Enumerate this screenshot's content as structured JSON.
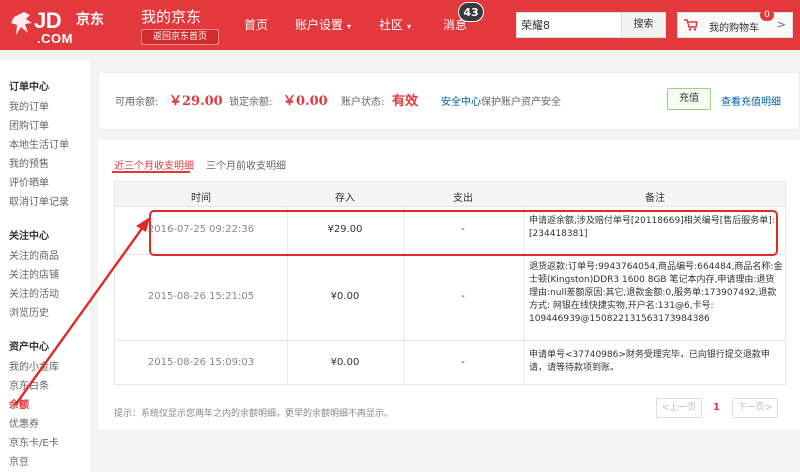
{
  "header": {
    "logo_text": "JD",
    "logo_cn": "京东",
    "logo_com": ".COM",
    "title": "我的京东",
    "back_home": "返回京东首页",
    "nav": [
      {
        "label": "首页"
      },
      {
        "label": "账户设置",
        "arrow": "▾"
      },
      {
        "label": "社区",
        "arrow": "▾"
      },
      {
        "label": "消息"
      }
    ],
    "message_count": "43",
    "search_value": "荣耀8",
    "search_button": "搜索",
    "cart_label": "我的购物车",
    "cart_count": "0",
    "cart_chevron": ">",
    "brand_color": "#e4393c"
  },
  "sidebar": {
    "sections": [
      {
        "title": "订单中心",
        "items": [
          "我的订单",
          "团购订单",
          "本地生活订单",
          "我的预售",
          "评价晒单",
          "取消订单记录"
        ]
      },
      {
        "title": "关注中心",
        "items": [
          "关注的商品",
          "关注的店铺",
          "关注的活动",
          "浏览历史"
        ]
      },
      {
        "title": "资产中心",
        "items": [
          "我的小金库",
          "京东白条",
          "余额",
          "优惠券",
          "京东卡/E卡",
          "京豆"
        ]
      }
    ],
    "active_item": "余额"
  },
  "balance": {
    "available_label": "可用余额:",
    "available_amount": "￥29.00",
    "locked_label": "锁定余额:",
    "locked_amount": "￥0.00",
    "status_label": "账户状态:",
    "status_value": "有效",
    "security_link": "安全中心",
    "security_text": "保护账户资产安全",
    "recharge_button": "充值",
    "view_recharge": "查看充值明细"
  },
  "details": {
    "tabs": [
      "近三个月收支明细",
      "三个月前收支明细"
    ],
    "columns": [
      "时间",
      "存入",
      "支出",
      "备注"
    ],
    "rows": [
      {
        "time": "2016-07-25 09:22:36",
        "deposit": "¥29.00",
        "expense": "-",
        "note": "申请返余额,涉及赔付单号[20118669]相关编号[售后服务单]:[234418381]"
      },
      {
        "time": "2015-08-26 15:21:05",
        "deposit": "¥0.00",
        "expense": "-",
        "note": "退货返款:订单号:9943764054,商品编号:664484,商品名称:金士顿(Kingston)DDR3 1600 8GB 笔记本内存,申请理由:退货理由:null差额原因:其它,退款金额:0,服务单:173907492,退款方式: 网银在线快捷实物,开户名:131@6,卡号: 109446939@150822131563173984386"
      },
      {
        "time": "2015-08-26 15:09:03",
        "deposit": "¥0.00",
        "expense": "-",
        "note": "申请单号<37740986>财务受理完毕，已向银行提交退款申请，请等待款项到账。"
      }
    ],
    "hint": "提示：系统仅显示您两年之内的余额明细，更早的余额明细不再显示。",
    "pager": {
      "prev": "上一页",
      "current": "1",
      "next": "下一页"
    }
  }
}
